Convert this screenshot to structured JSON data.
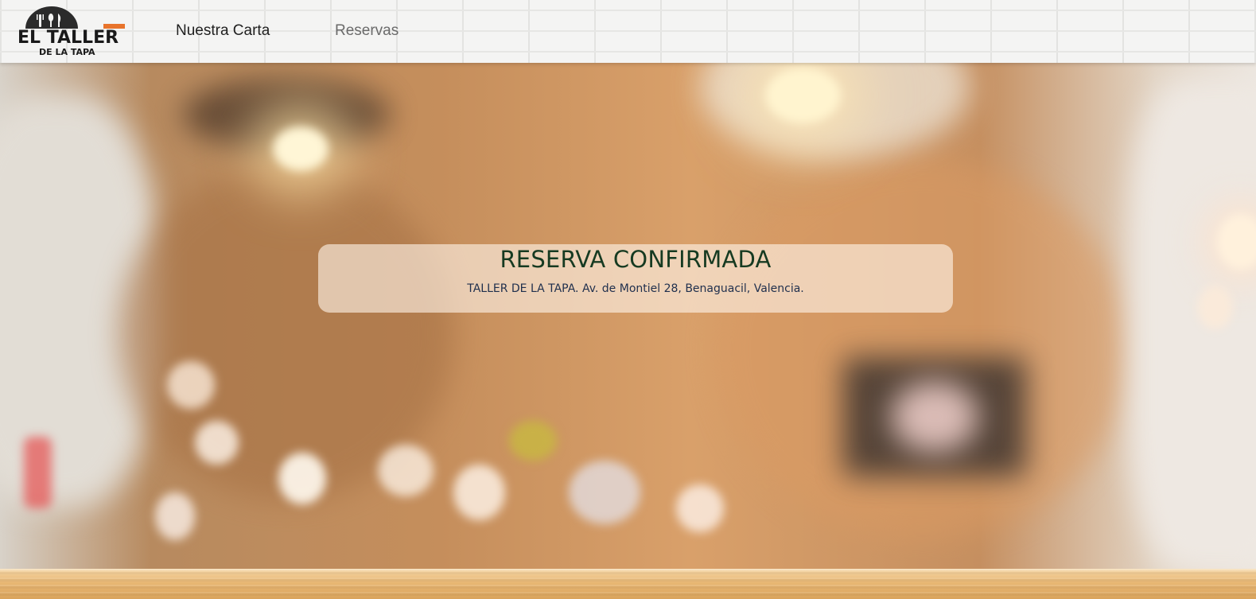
{
  "header": {
    "logo": {
      "line1": "EL TALLER",
      "line2": "DE LA TAPA",
      "icon": "utensils-icon",
      "colors": {
        "dark": "#1a1a1a",
        "accent": "#e8742c"
      }
    },
    "nav": [
      {
        "label": "Nuestra Carta"
      },
      {
        "label": "Reservas"
      }
    ]
  },
  "confirmation": {
    "title": "RESERVA CONFIRMADA",
    "address": "TALLER DE LA TAPA. Av. de Montiel 28, Benaguacil, Valencia."
  },
  "colors": {
    "title": "#163a21",
    "address": "#1f2f4d",
    "card_background": "rgba(255,244,232,0.62)"
  }
}
